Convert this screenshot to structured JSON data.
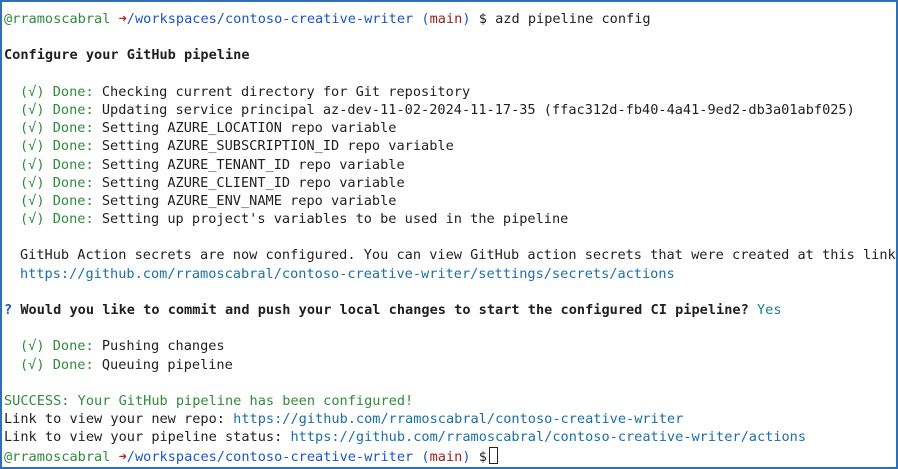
{
  "prompt": {
    "user": "@rramoscabral",
    "arrow": "➜",
    "path": "/workspaces/contoso-creative-writer",
    "branch": "main",
    "symbol": "$",
    "command": "azd pipeline config"
  },
  "heading": "Configure your GitHub pipeline",
  "done_prefix": "(√) Done:",
  "steps": [
    "Checking current directory for Git repository",
    "Updating service principal az-dev-11-02-2024-11-17-35 (ffac312d-fb40-4a41-9ed2-db3a01abf025)",
    "Setting AZURE_LOCATION repo variable",
    "Setting AZURE_SUBSCRIPTION_ID repo variable",
    "Setting AZURE_TENANT_ID repo variable",
    "Setting AZURE_CLIENT_ID repo variable",
    "Setting AZURE_ENV_NAME repo variable",
    "Setting up project's variables to be used in the pipeline"
  ],
  "secrets": {
    "message": "GitHub Action secrets are now configured. You can view GitHub action secrets that were created at this link:",
    "link": "https://github.com/rramoscabral/contoso-creative-writer/settings/secrets/actions"
  },
  "question": {
    "mark": "?",
    "text": "Would you like to commit and push your local changes to start the configured CI pipeline?",
    "answer": "Yes"
  },
  "push_steps": [
    "Pushing changes",
    "Queuing pipeline"
  ],
  "result": {
    "success": "SUCCESS: Your GitHub pipeline has been configured!",
    "repo_label": "Link to view your new repo:",
    "repo_link": "https://github.com/rramoscabral/contoso-creative-writer",
    "status_label": "Link to view your pipeline status:",
    "status_link": "https://github.com/rramoscabral/contoso-creative-writer/actions"
  },
  "colors": {
    "border": "#2f6fb3",
    "success_green": "#2e8b3a",
    "path_blue": "#1a55c8",
    "branch_maroon": "#9b1c1c",
    "arrow_red": "#c41e1e",
    "link": "#1a6fa8"
  }
}
